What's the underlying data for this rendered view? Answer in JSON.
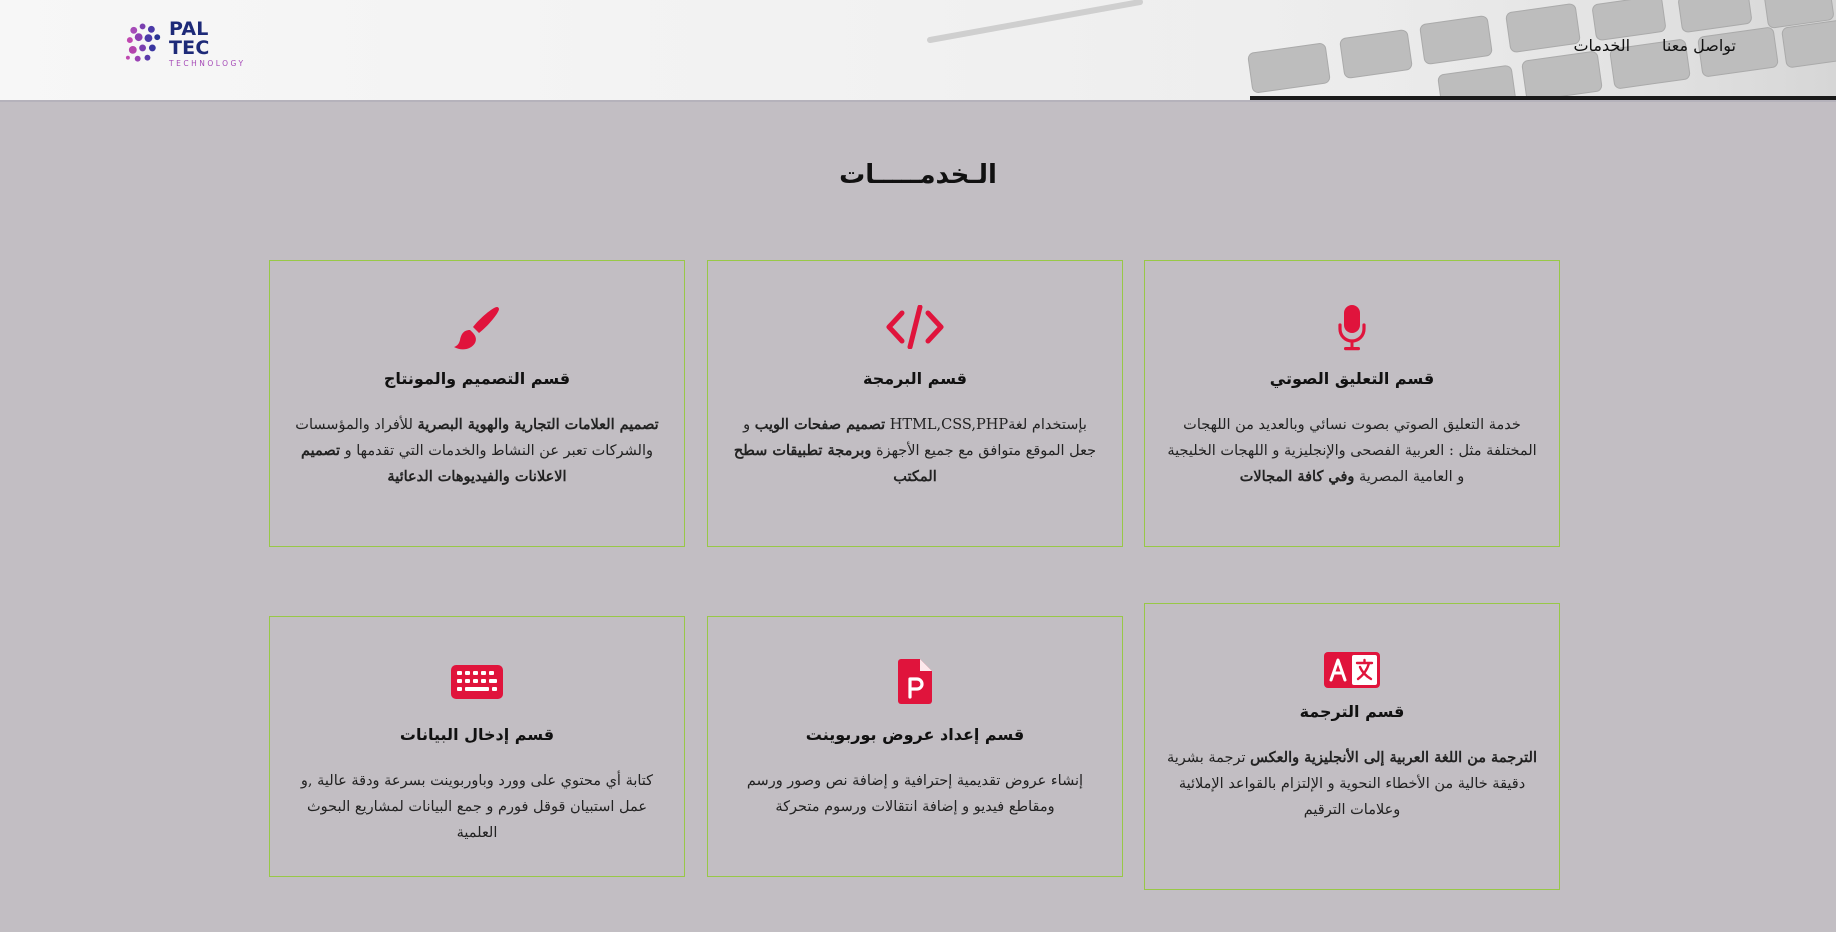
{
  "header": {
    "logo_main": "PAL TEC",
    "logo_sub": "TECHNOLOGY",
    "nav": [
      {
        "label": "الخدمات"
      },
      {
        "label": "تواصل معنا"
      }
    ]
  },
  "page_title": "الـخدمـــــات",
  "colors": {
    "accent": "#e0143c",
    "card_border": "#98c847",
    "background": "#c2bec3",
    "logo_navy": "#1d2a78",
    "logo_purple": "#a64bb8"
  },
  "cards": [
    {
      "icon": "microphone-icon",
      "title": "قسم التعليق الصوتي",
      "text_parts": [
        "خدمة التعليق الصوتي بصوت نسائي وبالعديد من اللهجات المختلفة مثل : العربية الفصحى والإنجليزية و اللهجات الخليجية و العامية المصرية ",
        "وفي كافة المجالات",
        ""
      ]
    },
    {
      "icon": "code-icon",
      "title": "قسم البرمجة",
      "text_parts": [
        "بإستخدام لغةHTML,CSS,PHP ",
        "تصميم صفحات الويب",
        " و جعل الموقع متوافق مع جميع الأجهزة ",
        "وبرمجة تطبيقات سطح المكتب"
      ]
    },
    {
      "icon": "paintbrush-icon",
      "title": "قسم التصميم والمونتاج",
      "text_parts": [
        "",
        "تصميم العلامات التجارية والهوية البصرية",
        " للأفراد والمؤسسات والشركات تعبر عن النشاط والخدمات التي تقدمها و ",
        "تصميم الاعلانات والفيديوهات الدعائية"
      ]
    },
    {
      "icon": "translate-icon",
      "title": "قسم الترجمة",
      "text_parts": [
        "",
        "الترجمة من اللغة العربية إلى الأنجليزية والعكس",
        " ترجمة بشرية دقيقة خالية من الأخطاء النحوية و الإلتزام بالقواعد الإملائية وعلامات الترقيم",
        ""
      ]
    },
    {
      "icon": "powerpoint-file-icon",
      "title": "قسم إعداد عروض بوربوينت",
      "text_parts": [
        "إنشاء عروض تقديمية إحترافية و إضافة نص وصور ورسم ومقاطع فيديو و إضافة انتقالات ورسوم متحركة",
        "",
        "",
        ""
      ]
    },
    {
      "icon": "keyboard-icon",
      "title": "قسم إدخال البيانات",
      "text_parts": [
        "كتابة أي محتوي على وورد وباوربوينت بسرعة ودقة عالية ,و عمل استبيان قوقل فورم و جمع البيانات لمشاريع البحوث العلمية",
        "",
        "",
        ""
      ]
    }
  ]
}
